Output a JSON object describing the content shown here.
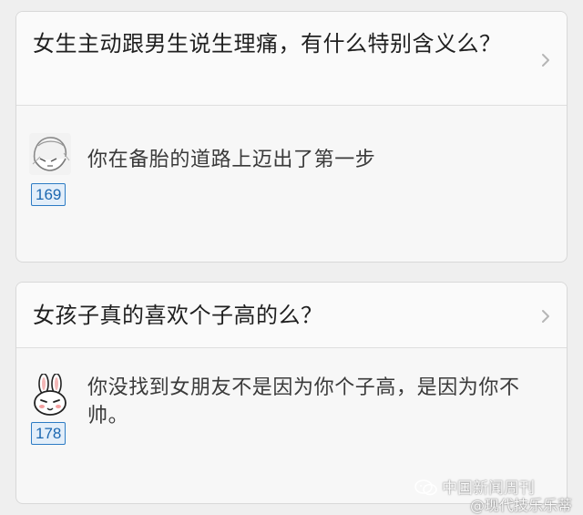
{
  "cards": [
    {
      "question": "女生主动跟男生说生理痛，有什么特别含义么？",
      "answer": "你在备胎的道路上迈出了第一步",
      "votes": "169",
      "avatar": "sketch-face-icon"
    },
    {
      "question": "女孩子真的喜欢个子高的么？",
      "answer": "你没找到女朋友不是因为你个子高，是因为你不帅。",
      "votes": "178",
      "avatar": "rabbit-icon"
    }
  ],
  "watermark": {
    "source": "中国新闻周刊",
    "handle": "@现代技乐乐蒂"
  },
  "colors": {
    "badge_border": "#2c7bc4",
    "badge_text": "#1b67b0",
    "card_bg": "#f7f7f7"
  }
}
